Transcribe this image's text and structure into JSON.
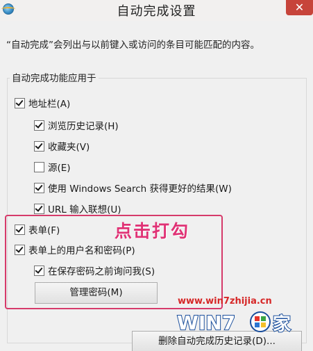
{
  "window": {
    "title": "自动完成设置",
    "close_label": "✕"
  },
  "description": "“自动完成”会列出与以前键入或访问的条目可能匹配的内容。",
  "group": {
    "legend": "自动完成功能应用于",
    "items": [
      {
        "label": "地址栏(A)",
        "checked": true
      },
      {
        "label": "浏览历史记录(H)",
        "checked": true
      },
      {
        "label": "收藏夹(V)",
        "checked": true
      },
      {
        "label": "源(E)",
        "checked": false
      },
      {
        "label": "使用 Windows Search 获得更好的结果(W)",
        "checked": true
      },
      {
        "label": "URL 输入联想(U)",
        "checked": true
      },
      {
        "label": "表单(F)",
        "checked": true
      },
      {
        "label": "表单上的用户名和密码(P)",
        "checked": true
      },
      {
        "label": "在保存密码之前询问我(S)",
        "checked": true
      }
    ]
  },
  "buttons": {
    "manage_passwords": "管理密码(M)",
    "delete_history": "删除自动完成历史记录(D)..."
  },
  "annotation": {
    "text": "点击打勾",
    "color": "#e03275"
  },
  "watermark": {
    "url": "www.win7zhijia.cn",
    "logo_text": "WIN7",
    "logo_suffix": "家"
  },
  "colors": {
    "highlight_border": "#d63a6a",
    "close_button": "#c7443a"
  }
}
